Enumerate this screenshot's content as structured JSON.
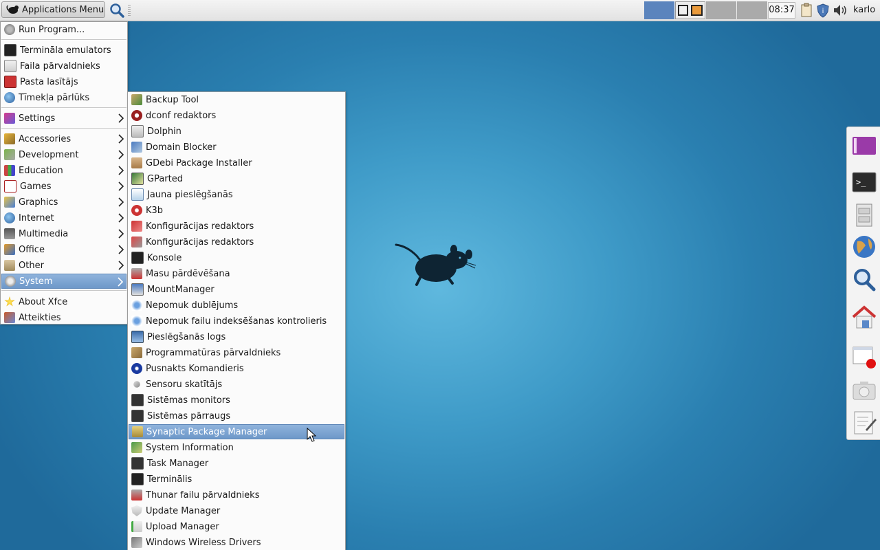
{
  "panel": {
    "apps_menu_label": "Applications Menu",
    "clock": "08:37",
    "user": "karlo"
  },
  "main_menu": {
    "items": [
      {
        "label": "Run Program...",
        "icon": "run-program-icon"
      },
      {
        "label": "Termināla emulators",
        "icon": "terminal-icon"
      },
      {
        "label": "Faila pārvaldnieks",
        "icon": "file-manager-icon"
      },
      {
        "label": "Pasta lasītājs",
        "icon": "mail-reader-icon"
      },
      {
        "label": "Tīmekļa pārlūks",
        "icon": "web-browser-icon"
      },
      {
        "label": "Settings",
        "icon": "settings-icon",
        "submenu": true
      },
      {
        "label": "Accessories",
        "icon": "accessories-icon",
        "submenu": true
      },
      {
        "label": "Development",
        "icon": "development-icon",
        "submenu": true
      },
      {
        "label": "Education",
        "icon": "education-icon",
        "submenu": true
      },
      {
        "label": "Games",
        "icon": "games-icon",
        "submenu": true
      },
      {
        "label": "Graphics",
        "icon": "graphics-icon",
        "submenu": true
      },
      {
        "label": "Internet",
        "icon": "internet-icon",
        "submenu": true
      },
      {
        "label": "Multimedia",
        "icon": "multimedia-icon",
        "submenu": true
      },
      {
        "label": "Office",
        "icon": "office-icon",
        "submenu": true
      },
      {
        "label": "Other",
        "icon": "other-icon",
        "submenu": true
      },
      {
        "label": "System",
        "icon": "system-icon",
        "submenu": true,
        "selected": true
      },
      {
        "label": "About Xfce",
        "icon": "star-icon"
      },
      {
        "label": "Atteikties",
        "icon": "logout-icon"
      }
    ]
  },
  "system_menu": {
    "items": [
      {
        "label": "Backup Tool"
      },
      {
        "label": "dconf redaktors"
      },
      {
        "label": "Dolphin"
      },
      {
        "label": "Domain Blocker"
      },
      {
        "label": "GDebi Package Installer"
      },
      {
        "label": "GParted"
      },
      {
        "label": "Jauna pieslēgšanās"
      },
      {
        "label": "K3b"
      },
      {
        "label": "Konfigurācijas redaktors"
      },
      {
        "label": "Konfigurācijas redaktors"
      },
      {
        "label": "Konsole"
      },
      {
        "label": "Masu pārdēvēšana"
      },
      {
        "label": "MountManager"
      },
      {
        "label": "Nepomuk dublējums"
      },
      {
        "label": "Nepomuk failu indeksēšanas kontrolieris"
      },
      {
        "label": "Pieslēgšanās logs"
      },
      {
        "label": "Programmatūras pārvaldnieks"
      },
      {
        "label": "Pusnakts Komandieris"
      },
      {
        "label": "Sensoru skatītājs"
      },
      {
        "label": "Sistēmas monitors"
      },
      {
        "label": "Sistēmas pārraugs"
      },
      {
        "label": "Synaptic Package Manager",
        "selected": true
      },
      {
        "label": "System Information"
      },
      {
        "label": "Task Manager"
      },
      {
        "label": "Terminālis"
      },
      {
        "label": "Thunar failu pārvaldnieks"
      },
      {
        "label": "Update Manager"
      },
      {
        "label": "Upload Manager"
      },
      {
        "label": "Windows Wireless Drivers"
      }
    ]
  },
  "dock": {
    "items": [
      {
        "icon": "workspace-switcher-icon"
      },
      {
        "icon": "terminal-icon"
      },
      {
        "icon": "file-cabinet-icon"
      },
      {
        "icon": "web-browser-icon"
      },
      {
        "icon": "search-icon"
      },
      {
        "icon": "home-folder-icon"
      },
      {
        "icon": "screen-recorder-icon"
      },
      {
        "icon": "camera-icon"
      },
      {
        "icon": "text-editor-icon"
      }
    ]
  },
  "colors": {
    "selection": "#7aa2d0",
    "desktop": "#3f9bc8"
  }
}
